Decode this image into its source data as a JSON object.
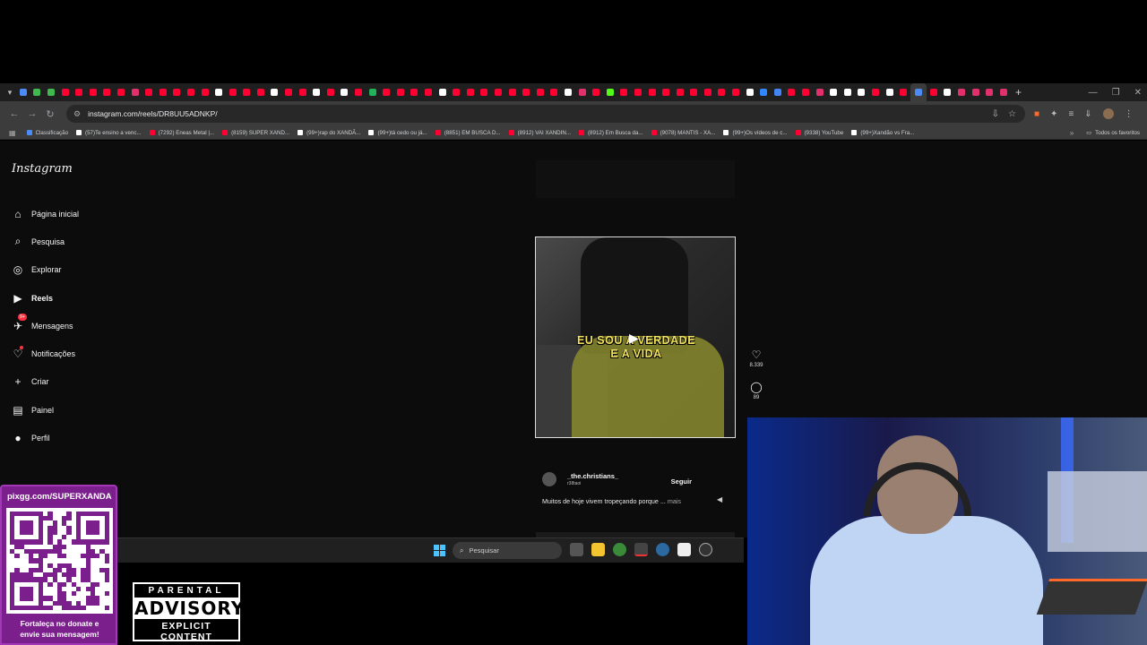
{
  "browser": {
    "url": "instagram.com/reels/DR8UU5ADNKP/",
    "tab_colors": [
      "#4c8bf5",
      "#3fb950",
      "#3fb950",
      "#ff0033",
      "#ff0033",
      "#ff0033",
      "#ff0033",
      "#ff0033",
      "#e1306c",
      "#ff0033",
      "#ff0033",
      "#ff0033",
      "#ff0033",
      "#ff0033",
      "#ffffff",
      "#ff0033",
      "#ff0033",
      "#ff0033",
      "#ffffff",
      "#ff0033",
      "#ff0033",
      "#ffffff",
      "#ff0033",
      "#ffffff",
      "#ff0033",
      "#21b25a",
      "#ff0033",
      "#ff0033",
      "#ff0033",
      "#ff0033",
      "#ffffff",
      "#ff0033",
      "#ff0033",
      "#ff0033",
      "#ff0033",
      "#ff0033",
      "#ff0033",
      "#ff0033",
      "#ff0033",
      "#ffffff",
      "#e1306c",
      "#ff0033",
      "#53fc18",
      "#ff0033",
      "#ff0033",
      "#ff0033",
      "#ff0033",
      "#ff0033",
      "#ff0033",
      "#ff0033",
      "#ff0033",
      "#ff0033",
      "#ffffff",
      "#2f88ff",
      "#4285f4",
      "#ff0033",
      "#ff0033",
      "#e1306c",
      "#ffffff",
      "#ffffff",
      "#ffffff",
      "#ff0033",
      "#ffffff",
      "#ff0033",
      "#4c8bf5",
      "#ff0033",
      "#ffffff",
      "#e1306c",
      "#e1306c",
      "#e1306c",
      "#e1306c"
    ],
    "new_tab": "+"
  },
  "bookmarks": [
    {
      "label": "Classificação",
      "color": "#4c8bf5"
    },
    {
      "label": "(57)Te ensino a venc...",
      "color": "#ffffff"
    },
    {
      "label": "(7292) Eneas Metal |...",
      "color": "#ff0033"
    },
    {
      "label": "(8159) SUPER XAND...",
      "color": "#ff0033"
    },
    {
      "label": "(99+)rap do XANDÃ...",
      "color": "#ffffff"
    },
    {
      "label": "(99+)tá cedo ou já...",
      "color": "#ffffff"
    },
    {
      "label": "(8851) EM BUSCA D...",
      "color": "#ff0033"
    },
    {
      "label": "(8912) VAI XANDIN...",
      "color": "#ff0033"
    },
    {
      "label": "(8912) Em Busca da...",
      "color": "#ff0033"
    },
    {
      "label": "(9078) MANTIS - XA...",
      "color": "#ff0033"
    },
    {
      "label": "(99+)Os vídeos de c...",
      "color": "#ffffff"
    },
    {
      "label": "(9338) YouTube",
      "color": "#ff0033"
    },
    {
      "label": "(99+)Xandão vs Fra...",
      "color": "#ffffff"
    }
  ],
  "bookmarks_all": "Todos os favoritos",
  "instagram": {
    "logo": "Instagram",
    "nav": [
      {
        "label": "Página inicial",
        "icon": "⌂",
        "name": "home"
      },
      {
        "label": "Pesquisa",
        "icon": "⌕",
        "name": "search"
      },
      {
        "label": "Explorar",
        "icon": "◎",
        "name": "explore"
      },
      {
        "label": "Reels",
        "icon": "▶",
        "name": "reels"
      },
      {
        "label": "Mensagens",
        "icon": "✈",
        "name": "messages"
      },
      {
        "label": "Notificações",
        "icon": "♡",
        "name": "notifications"
      },
      {
        "label": "Criar",
        "icon": "+",
        "name": "create"
      },
      {
        "label": "Painel",
        "icon": "▤",
        "name": "dashboard"
      },
      {
        "label": "Perfil",
        "icon": "●",
        "name": "profile"
      }
    ],
    "messages_badge": "9+",
    "reel": {
      "caption_line1": "EU SOU A VERDADE",
      "caption_line2": "E A VIDA",
      "likes": "8.339",
      "comments": "89",
      "username": "_the.christians_",
      "audio": "r38taoi",
      "follow": "Seguir",
      "description": "Muitos de hoje vivem tropeçando porque ...",
      "more": "mais"
    }
  },
  "taskbar": {
    "search_placeholder": "Pesquisar"
  },
  "overlay": {
    "donate_url": "pixgg.com/SUPERXANDA",
    "donate_text_1": "Fortaleça no donate e",
    "donate_text_2": "envie sua mensagem!",
    "advisory_top": "PARENTAL",
    "advisory_mid": "ADVISORY",
    "advisory_bot": "EXPLICIT CONTENT"
  }
}
